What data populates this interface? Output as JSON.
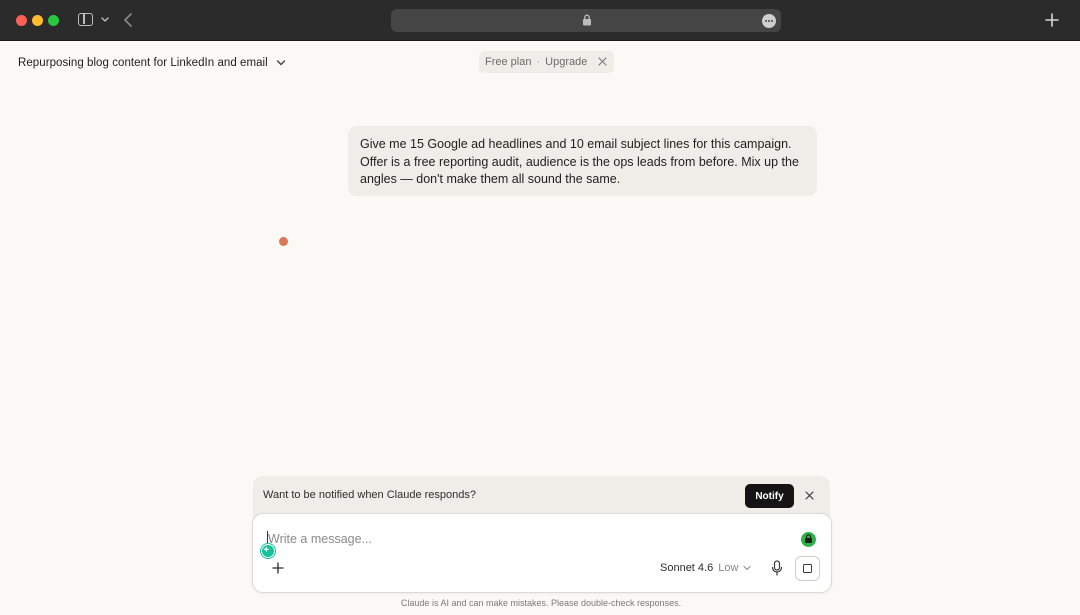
{
  "browser": {
    "icons": [
      "close-window-icon",
      "minimize-window-icon",
      "zoom-window-icon",
      "sidebar-icon",
      "chevron-down-icon",
      "back-arrow-icon",
      "lock-icon",
      "more-icon",
      "new-tab-icon"
    ],
    "colors": {
      "chrome": "#2b2b2b",
      "urlbar": "#454545"
    }
  },
  "header": {
    "chat_title": "Repurposing blog content for LinkedIn and email",
    "plan": {
      "label": "Free plan",
      "separator": "·",
      "upgrade": "Upgrade"
    }
  },
  "conversation": {
    "messages": [
      {
        "role": "user",
        "text": "Give me 15 Google ad headlines and 10 email subject lines for this campaign. Offer is a free reporting audit, audience is the ops leads from before. Mix up the angles — don't make them all sound the same."
      }
    ],
    "assistant_status": "thinking",
    "accent": "#d97757"
  },
  "notify_banner": {
    "text": "Want to be notified when Claude responds?",
    "button": "Notify"
  },
  "composer": {
    "placeholder": "Write a message...",
    "value": "",
    "model": "Sonnet 4.6",
    "effort": "Low"
  },
  "footer": {
    "disclaimer": "Claude is AI and can make mistakes. Please double-check responses."
  }
}
